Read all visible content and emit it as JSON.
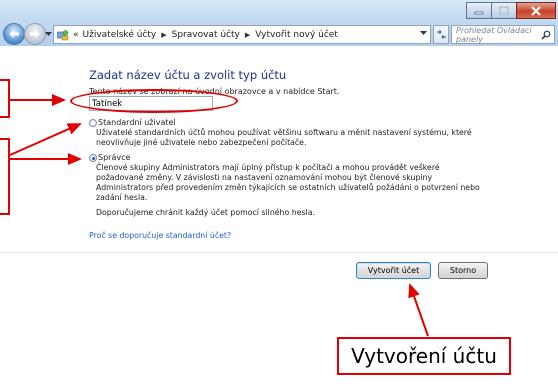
{
  "breadcrumb": [
    "Uživatelské účty",
    "Spravovat účty",
    "Vytvořit nový účet"
  ],
  "breadcrumb_prefix": "«",
  "search": {
    "placeholder": "Prohledat Ovládací panely"
  },
  "content": {
    "heading": "Zadat název účtu a zvolit typ účtu",
    "name_hint": "Tento název se zobrazí na úvodní obrazovce a v nabídce Start.",
    "account_name": "Tatínek",
    "standard": {
      "title": "Standardní uživatel",
      "description": "Uživatelé standardních účtů mohou používat většinu softwaru a měnit nastavení systému, které neovlivňuje jiné uživatele nebo zabezpečení počítače.",
      "selected": false
    },
    "admin": {
      "title": "Správce",
      "description": "Členové skupiny Administrators mají úplný přístup k počítači a mohou provádět veškeré požadované změny. V závislosti na nastavení oznamování mohou být členové skupiny Administrators před provedením změn týkajících se ostatních uživatelů požádáni o potvrzení nebo zadání hesla.",
      "recommendation": "Doporučujeme chránit každý účet pomocí silného hesla.",
      "selected": true
    },
    "help_link": "Proč se doporučuje standardní účet?",
    "create_button": "Vytvořit účet",
    "cancel_button": "Storno"
  },
  "annotation": {
    "callout": "Vytvoření účtu",
    "color": "#e30000"
  },
  "icons": [
    "back-arrow-icon",
    "forward-arrow-icon",
    "control-panel-icon",
    "refresh-icon",
    "search-icon",
    "minimize-icon",
    "maximize-icon",
    "close-icon"
  ]
}
